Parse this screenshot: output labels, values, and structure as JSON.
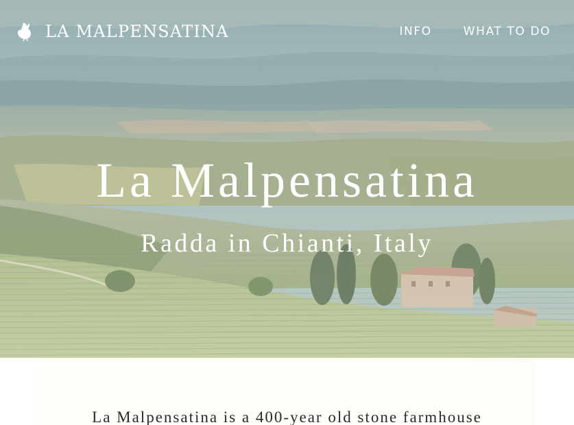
{
  "brand": {
    "logo_icon": "rooster-icon",
    "name": "LA MALPENSATINA"
  },
  "nav": {
    "items": [
      {
        "label": "INFO"
      },
      {
        "label": "WHAT TO DO"
      }
    ]
  },
  "hero": {
    "title": "La Malpensatina",
    "subtitle": "Radda in Chianti, Italy",
    "image": "tuscan-vineyard-landscape"
  },
  "content": {
    "intro_text": "La Malpensatina is a 400-year old stone farmhouse"
  },
  "colors": {
    "text_on_hero": "#ffffff",
    "body_text": "#2b2b2b",
    "content_background": "#fffdf7"
  }
}
